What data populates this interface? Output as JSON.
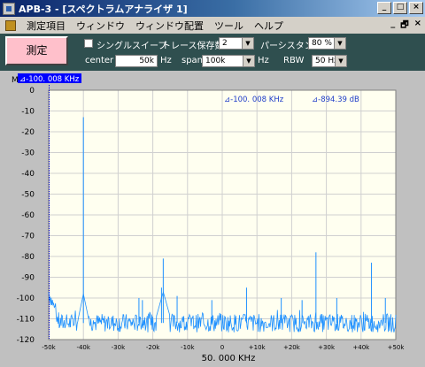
{
  "window": {
    "title": "APB-3 - [スペクトラムアナライザ 1]",
    "min": "_",
    "max": "□",
    "close": "×"
  },
  "menu": {
    "items": [
      "測定項目",
      "ウィンドウ",
      "ウィンドウ配置",
      "ツール",
      "ヘルプ"
    ],
    "mdi_min": "_",
    "mdi_restore": "🗗",
    "mdi_close": "×"
  },
  "toolbar": {
    "measure_label": "測定",
    "single_sweep_label": "シングルスイープ",
    "single_sweep_checked": false,
    "trace_keep_label": "トレース保存数",
    "trace_keep_value": "2",
    "persistence_label": "パーシスタンス",
    "persistence_value": "80 %",
    "center_label": "center",
    "center_value": "50k",
    "center_unit": "Hz",
    "span_label": "span",
    "span_value": "100k",
    "span_unit": "Hz",
    "rbw_label": "RBW",
    "rbw_value": "50 Hz"
  },
  "chart": {
    "marker_letter": "M",
    "marker_readout": "⊿-100. 008 KHz",
    "delta_freq": "⊿-100. 008 KHz",
    "delta_level": "⊿-894.39 dB",
    "center_freq_label": "50. 000 KHz",
    "colors": {
      "plot_bg": "#fffff0",
      "grid": "#d0d0d0",
      "trace": "#1e90ff",
      "marker_box": "#0000ff",
      "text_blue": "#1e3cc8"
    }
  },
  "chart_data": {
    "type": "line",
    "xlim": [
      -50,
      50
    ],
    "ylim": [
      -120,
      0
    ],
    "x_ticks": [
      "-50k",
      "-40k",
      "-30k",
      "-20k",
      "-10k",
      "0",
      "+10k",
      "+20k",
      "+30k",
      "+40k",
      "+50k"
    ],
    "y_ticks": [
      "0",
      "-10",
      "-20",
      "-30",
      "-40",
      "-50",
      "-60",
      "-70",
      "-80",
      "-90",
      "-100",
      "-110",
      "-120"
    ],
    "noise_floor_db": -112,
    "peaks": [
      {
        "x": -40,
        "y": -13
      },
      {
        "x": -24,
        "y": -100
      },
      {
        "x": -23,
        "y": -101
      },
      {
        "x": -17,
        "y": -81
      },
      {
        "x": -17.5,
        "y": -95
      },
      {
        "x": -13,
        "y": -99
      },
      {
        "x": -3,
        "y": -101
      },
      {
        "x": 7,
        "y": -95
      },
      {
        "x": 17,
        "y": -100
      },
      {
        "x": 23,
        "y": -101
      },
      {
        "x": 27,
        "y": -78
      },
      {
        "x": 33,
        "y": -100
      },
      {
        "x": 43,
        "y": -83
      },
      {
        "x": 47,
        "y": -100
      }
    ],
    "marker_x": -50
  }
}
